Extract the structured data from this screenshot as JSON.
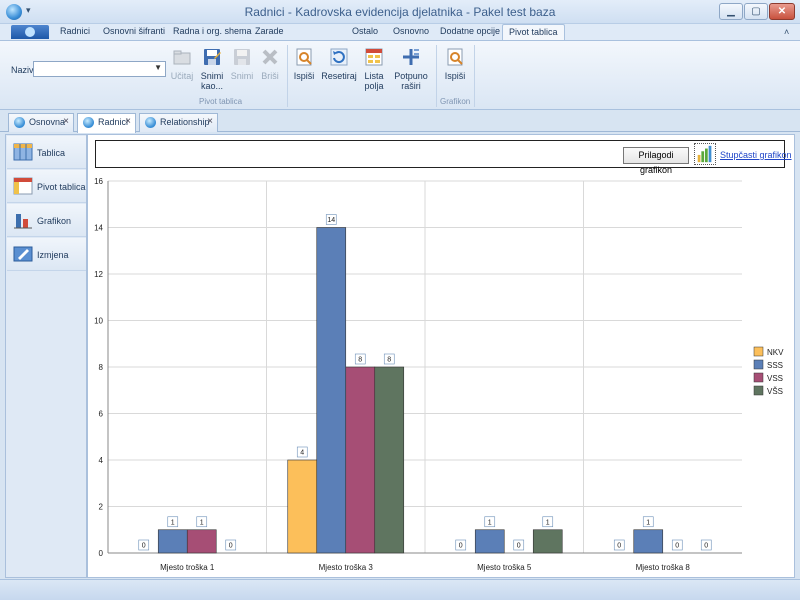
{
  "window": {
    "title": "Radnici - Kadrovska evidencija djelatnika - Pakel test baza"
  },
  "ribbon_tabs": [
    "Radnici",
    "Osnovni šifranti",
    "Radna i org. shema",
    "Zarade",
    "Ostalo",
    "Osnovno",
    "Dodatne opcije",
    "Pivot tablica"
  ],
  "ribbon_active_tab": "Pivot tablica",
  "ribbon": {
    "naziv_label": "Naziv",
    "naziv_value": "",
    "pivot_group": {
      "label": "Pivot tablica",
      "buttons": [
        {
          "label": "Učitaj",
          "enabled": false,
          "icon": "folder-open-icon"
        },
        {
          "label": "Snimi kao...",
          "enabled": true,
          "icon": "save-as-icon"
        },
        {
          "label": "Snimi",
          "enabled": false,
          "icon": "save-icon"
        },
        {
          "label": "Briši",
          "enabled": false,
          "icon": "delete-icon"
        },
        {
          "label": "Ispiši",
          "enabled": true,
          "icon": "print-preview-icon"
        },
        {
          "label": "Resetiraj",
          "enabled": true,
          "icon": "reset-icon"
        },
        {
          "label": "Lista polja",
          "enabled": true,
          "icon": "field-list-icon"
        },
        {
          "label": "Potpuno raširi",
          "enabled": true,
          "icon": "expand-all-icon"
        }
      ]
    },
    "grafikon_group": {
      "label": "Grafikon",
      "buttons": [
        {
          "label": "Ispiši",
          "enabled": true,
          "icon": "print-preview-icon"
        }
      ]
    }
  },
  "doc_tabs": [
    {
      "label": "Osnovna",
      "active": false
    },
    {
      "label": "Radnici",
      "active": true
    },
    {
      "label": "Relationship",
      "active": false
    }
  ],
  "left_nav": [
    {
      "label": "Tablica",
      "icon": "table-icon"
    },
    {
      "label": "Pivot tablica",
      "icon": "pivot-table-icon"
    },
    {
      "label": "Grafikon",
      "icon": "chart-icon"
    },
    {
      "label": "Izmjena",
      "icon": "edit-icon"
    }
  ],
  "chart_toolbar": {
    "customize_label": "Prilagodi grafikon",
    "chart_type_label": "Stupčasti grafikon"
  },
  "colors": {
    "NKV": "#fcbf5a",
    "SSS": "#5b7fb7",
    "VSS": "#a64e75",
    "VŠS": "#5f7560"
  },
  "chart_data": {
    "type": "bar",
    "categories": [
      "Mjesto troška 1",
      "Mjesto troška 3",
      "Mjesto troška 5",
      "Mjesto troška 8"
    ],
    "series": [
      {
        "name": "NKV",
        "values": [
          0,
          4,
          0,
          0
        ]
      },
      {
        "name": "SSS",
        "values": [
          1,
          14,
          1,
          1
        ]
      },
      {
        "name": "VSS",
        "values": [
          1,
          8,
          0,
          0
        ]
      },
      {
        "name": "VŠS",
        "values": [
          0,
          8,
          1,
          0
        ]
      }
    ],
    "ylim": [
      0,
      16
    ],
    "yticks": [
      0,
      2,
      4,
      6,
      8,
      10,
      12,
      14,
      16
    ],
    "grid": true,
    "legend": "right"
  }
}
